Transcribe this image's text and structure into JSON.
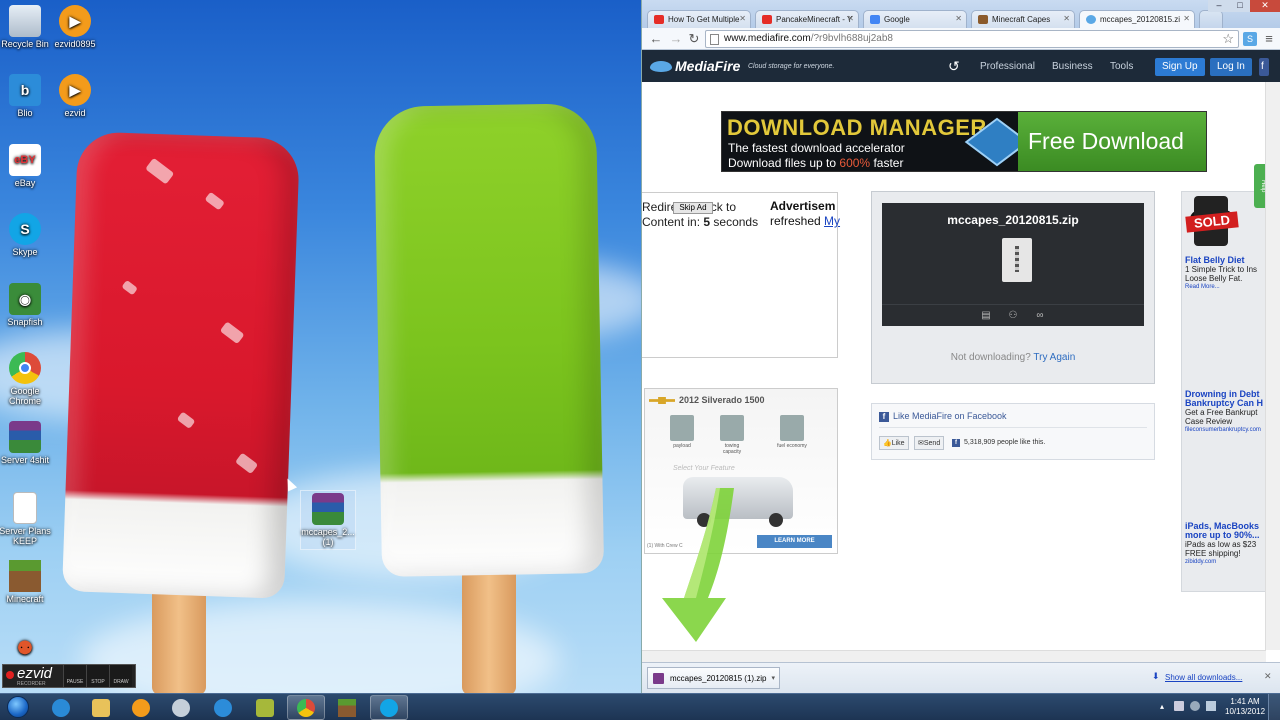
{
  "desktop": {
    "icons": [
      {
        "label": "Recycle Bin",
        "icon": "recycle-bin-icon",
        "color": "#c9d6e3"
      },
      {
        "label": "ezvid0895",
        "icon": "ezvid-play-icon",
        "color": "#f39b1b"
      },
      {
        "label": "Blio",
        "icon": "blio-icon",
        "color": "#2c8cd9"
      },
      {
        "label": "ezvid",
        "icon": "ezvid-play-icon",
        "color": "#f39b1b"
      },
      {
        "label": "eBay",
        "icon": "ebay-icon",
        "color": "#ffffff"
      },
      {
        "label": "Skype",
        "icon": "skype-icon",
        "color": "#12a5e6"
      },
      {
        "label": "Snapfish",
        "icon": "snapfish-icon",
        "color": "#3a8c3a"
      },
      {
        "label": "Google Chrome",
        "icon": "chrome-icon",
        "color": "#dd4b39"
      },
      {
        "label": "Server 4shit",
        "icon": "winrar-icon",
        "color": "#6b3a8c"
      },
      {
        "label": "Server Plans KEEP",
        "icon": "text-file-icon",
        "color": "#ffffff"
      },
      {
        "label": "Minecraft",
        "icon": "minecraft-grass-icon",
        "color": "#5a8a30"
      },
      {
        "label": "",
        "icon": "people-icon",
        "color": "#e0562a"
      }
    ],
    "dragged_file": {
      "label": "mccapes_2... (1)",
      "icon": "winrar-icon"
    },
    "ezvid_recorder": {
      "logo": "ezvid",
      "sublabel": "RECORDER",
      "buttons": [
        "PAUSE",
        "STOP",
        "DRAW"
      ]
    }
  },
  "browser": {
    "tabs": [
      {
        "title": "How To Get Multiple",
        "favicon_color": "#e52d27"
      },
      {
        "title": "PancakeMinecraft - Y",
        "favicon_color": "#e52d27"
      },
      {
        "title": "Google",
        "favicon_color": "#4285f4"
      },
      {
        "title": "Minecraft Capes",
        "favicon_color": "#8b5a2b"
      },
      {
        "title": "mccapes_20120815.zi",
        "favicon_color": "#5aa8e6",
        "active": true
      }
    ],
    "url_host": "www.mediafire.com",
    "url_path": "/?r9bvlh688uj2ab8",
    "window_buttons": {
      "minimize": "–",
      "maximize": "□",
      "close": "✕"
    }
  },
  "mediafire": {
    "logo": "MediaFire",
    "tagline": "Cloud storage for everyone.",
    "nav": [
      "Professional",
      "Business",
      "Tools"
    ],
    "signup": "Sign Up",
    "login": "Log In",
    "banner": {
      "headline": "DOWNLOAD MANAGER",
      "line1": "The fastest download accelerator",
      "line2_pre": "Download files up to ",
      "line2_pct": "600%",
      "line2_post": " faster",
      "cta": "Free Download"
    },
    "redirect": {
      "line1": "Redire",
      "line1b": "ck to",
      "line2": "Content in: ",
      "seconds": "5",
      "line2b": " seconds",
      "skip": "Skip Ad"
    },
    "advert": {
      "heading": "Advertisem",
      "line2": "refreshed ",
      "link": "My"
    },
    "file": {
      "name": "mccapes_20120815.zip",
      "not_downloading": "Not downloading?",
      "try_again": "Try Again"
    },
    "facebook": {
      "like_text": "Like MediaFire on Facebook",
      "like_btn": "Like",
      "send_btn": "Send",
      "count": "5,318,909 people like this."
    },
    "chevy_ad": {
      "title": "2012 Silverado 1500",
      "icons": [
        "payload",
        "towing capacity",
        "fuel economy"
      ],
      "select": "Select Your Feature",
      "footnote": "(1) With Crew C",
      "learn": "LEARN MORE"
    },
    "side_ads": [
      {
        "title": "Flat Belly Diet",
        "lines": [
          "1 Simple Trick to Ins",
          "Loose Belly Fat."
        ],
        "more": "Read More..."
      },
      {
        "title": "Drowning in Debt",
        "title2": "Bankruptcy Can H",
        "lines": [
          "Get a Free Bankrupt",
          "Case Review"
        ],
        "more": "fileconsumerbankruptcy.com"
      },
      {
        "title": "iPads, MacBooks",
        "title2": "more up to 90%...",
        "lines": [
          "iPads as low as $23",
          "FREE shipping!"
        ],
        "more": "zibiddy.com",
        "badge": "SOLD"
      }
    ],
    "help_tab": "Help"
  },
  "download_bar": {
    "file": "mccapes_20120815 (1).zip",
    "show_all": "Show all downloads...",
    "close": "✕"
  },
  "taskbar": {
    "apps": [
      {
        "icon": "internet-explorer-icon",
        "color": "#2a8ad6"
      },
      {
        "icon": "file-explorer-icon",
        "color": "#e8c25a"
      },
      {
        "icon": "ezvid-play-icon",
        "color": "#f39b1b"
      },
      {
        "icon": "hp-icon",
        "color": "#c5cfd9"
      },
      {
        "icon": "blio-icon",
        "color": "#2c8cd9"
      },
      {
        "icon": "server-tool-icon",
        "color": "#a6b83a"
      },
      {
        "icon": "chrome-icon",
        "color": "#dd4b39",
        "active": true
      },
      {
        "icon": "minecraft-grass-icon",
        "color": "#5a8a30"
      },
      {
        "icon": "skype-icon",
        "color": "#12a5e6",
        "active": true
      }
    ],
    "time": "1:41 AM",
    "date": "10/13/2012"
  }
}
